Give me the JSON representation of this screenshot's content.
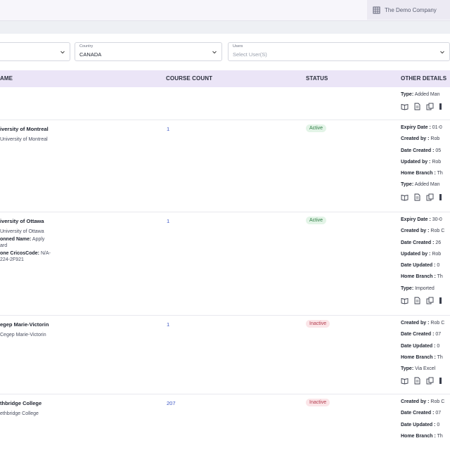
{
  "header": {
    "company": "The Demo Company"
  },
  "filters": {
    "first": {
      "value": ""
    },
    "country": {
      "label": "Country",
      "value": "CANADA"
    },
    "users": {
      "label": "Users",
      "placeholder": "Select User(S)"
    }
  },
  "table": {
    "columns": [
      "AME",
      "COURSE COUNT",
      "STATUS",
      "OTHER DETAILS"
    ],
    "rows": [
      {
        "name": "",
        "sub": "",
        "count": "",
        "status": "",
        "status_kind": "",
        "details": [
          {
            "k": "Type:",
            "v": " Added Man"
          }
        ],
        "icons": true
      },
      {
        "name": "iversity of Montreal",
        "sub": "University of Montreal",
        "count": "1",
        "status": "Active",
        "status_kind": "active",
        "details": [
          {
            "k": "Expiry Date :",
            "v": " 01-0"
          },
          {
            "k": "Created by :",
            "v": " Rob"
          },
          {
            "k": "Date Created :",
            "v": " 05"
          },
          {
            "k": "Updated by :",
            "v": " Rob"
          },
          {
            "k": "Home Branch :",
            "v": " Th"
          },
          {
            "k": "Type:",
            "v": " Added Man"
          }
        ],
        "icons": true
      },
      {
        "name": "iversity of Ottawa",
        "sub": "University of Ottawa",
        "extra1_k": "onned Name:",
        "extra1_v": " Apply",
        "extra1_cont": "ard",
        "extra2_k": "one CricosCode:",
        "extra2_v": " N/A-",
        "extra2_cont": "224-2F921",
        "count": "1",
        "status": "Active",
        "status_kind": "active",
        "details": [
          {
            "k": "Expiry Date :",
            "v": " 30-0"
          },
          {
            "k": "Created by :",
            "v": " Rob C"
          },
          {
            "k": "Date Created :",
            "v": " 26"
          },
          {
            "k": "Updated by :",
            "v": " Rob"
          },
          {
            "k": "Date Updated :",
            "v": " 0"
          },
          {
            "k": "Home Branch :",
            "v": " Th"
          },
          {
            "k": "Type:",
            "v": " Imported"
          }
        ],
        "icons": true
      },
      {
        "name": "egep Marie-Victorin",
        "sub": "Cegep Marie-Victorin",
        "count": "1",
        "status": "Inactive",
        "status_kind": "inactive",
        "details": [
          {
            "k": "Created by :",
            "v": " Rob C"
          },
          {
            "k": "Date Created :",
            "v": " 07"
          },
          {
            "k": "Date Updated :",
            "v": " 0"
          },
          {
            "k": "Home Branch :",
            "v": " Th"
          },
          {
            "k": "Type:",
            "v": " Via Excel"
          }
        ],
        "icons": true
      },
      {
        "name": "thbridge College",
        "sub": "ethbridge College",
        "count": "207",
        "status": "Inactive",
        "status_kind": "inactive",
        "details": [
          {
            "k": "Created by :",
            "v": " Rob C"
          },
          {
            "k": "Date Created :",
            "v": " 07"
          },
          {
            "k": "Date Updated :",
            "v": " 0"
          },
          {
            "k": "Home Branch :",
            "v": " Th"
          }
        ],
        "icons": false
      }
    ]
  }
}
